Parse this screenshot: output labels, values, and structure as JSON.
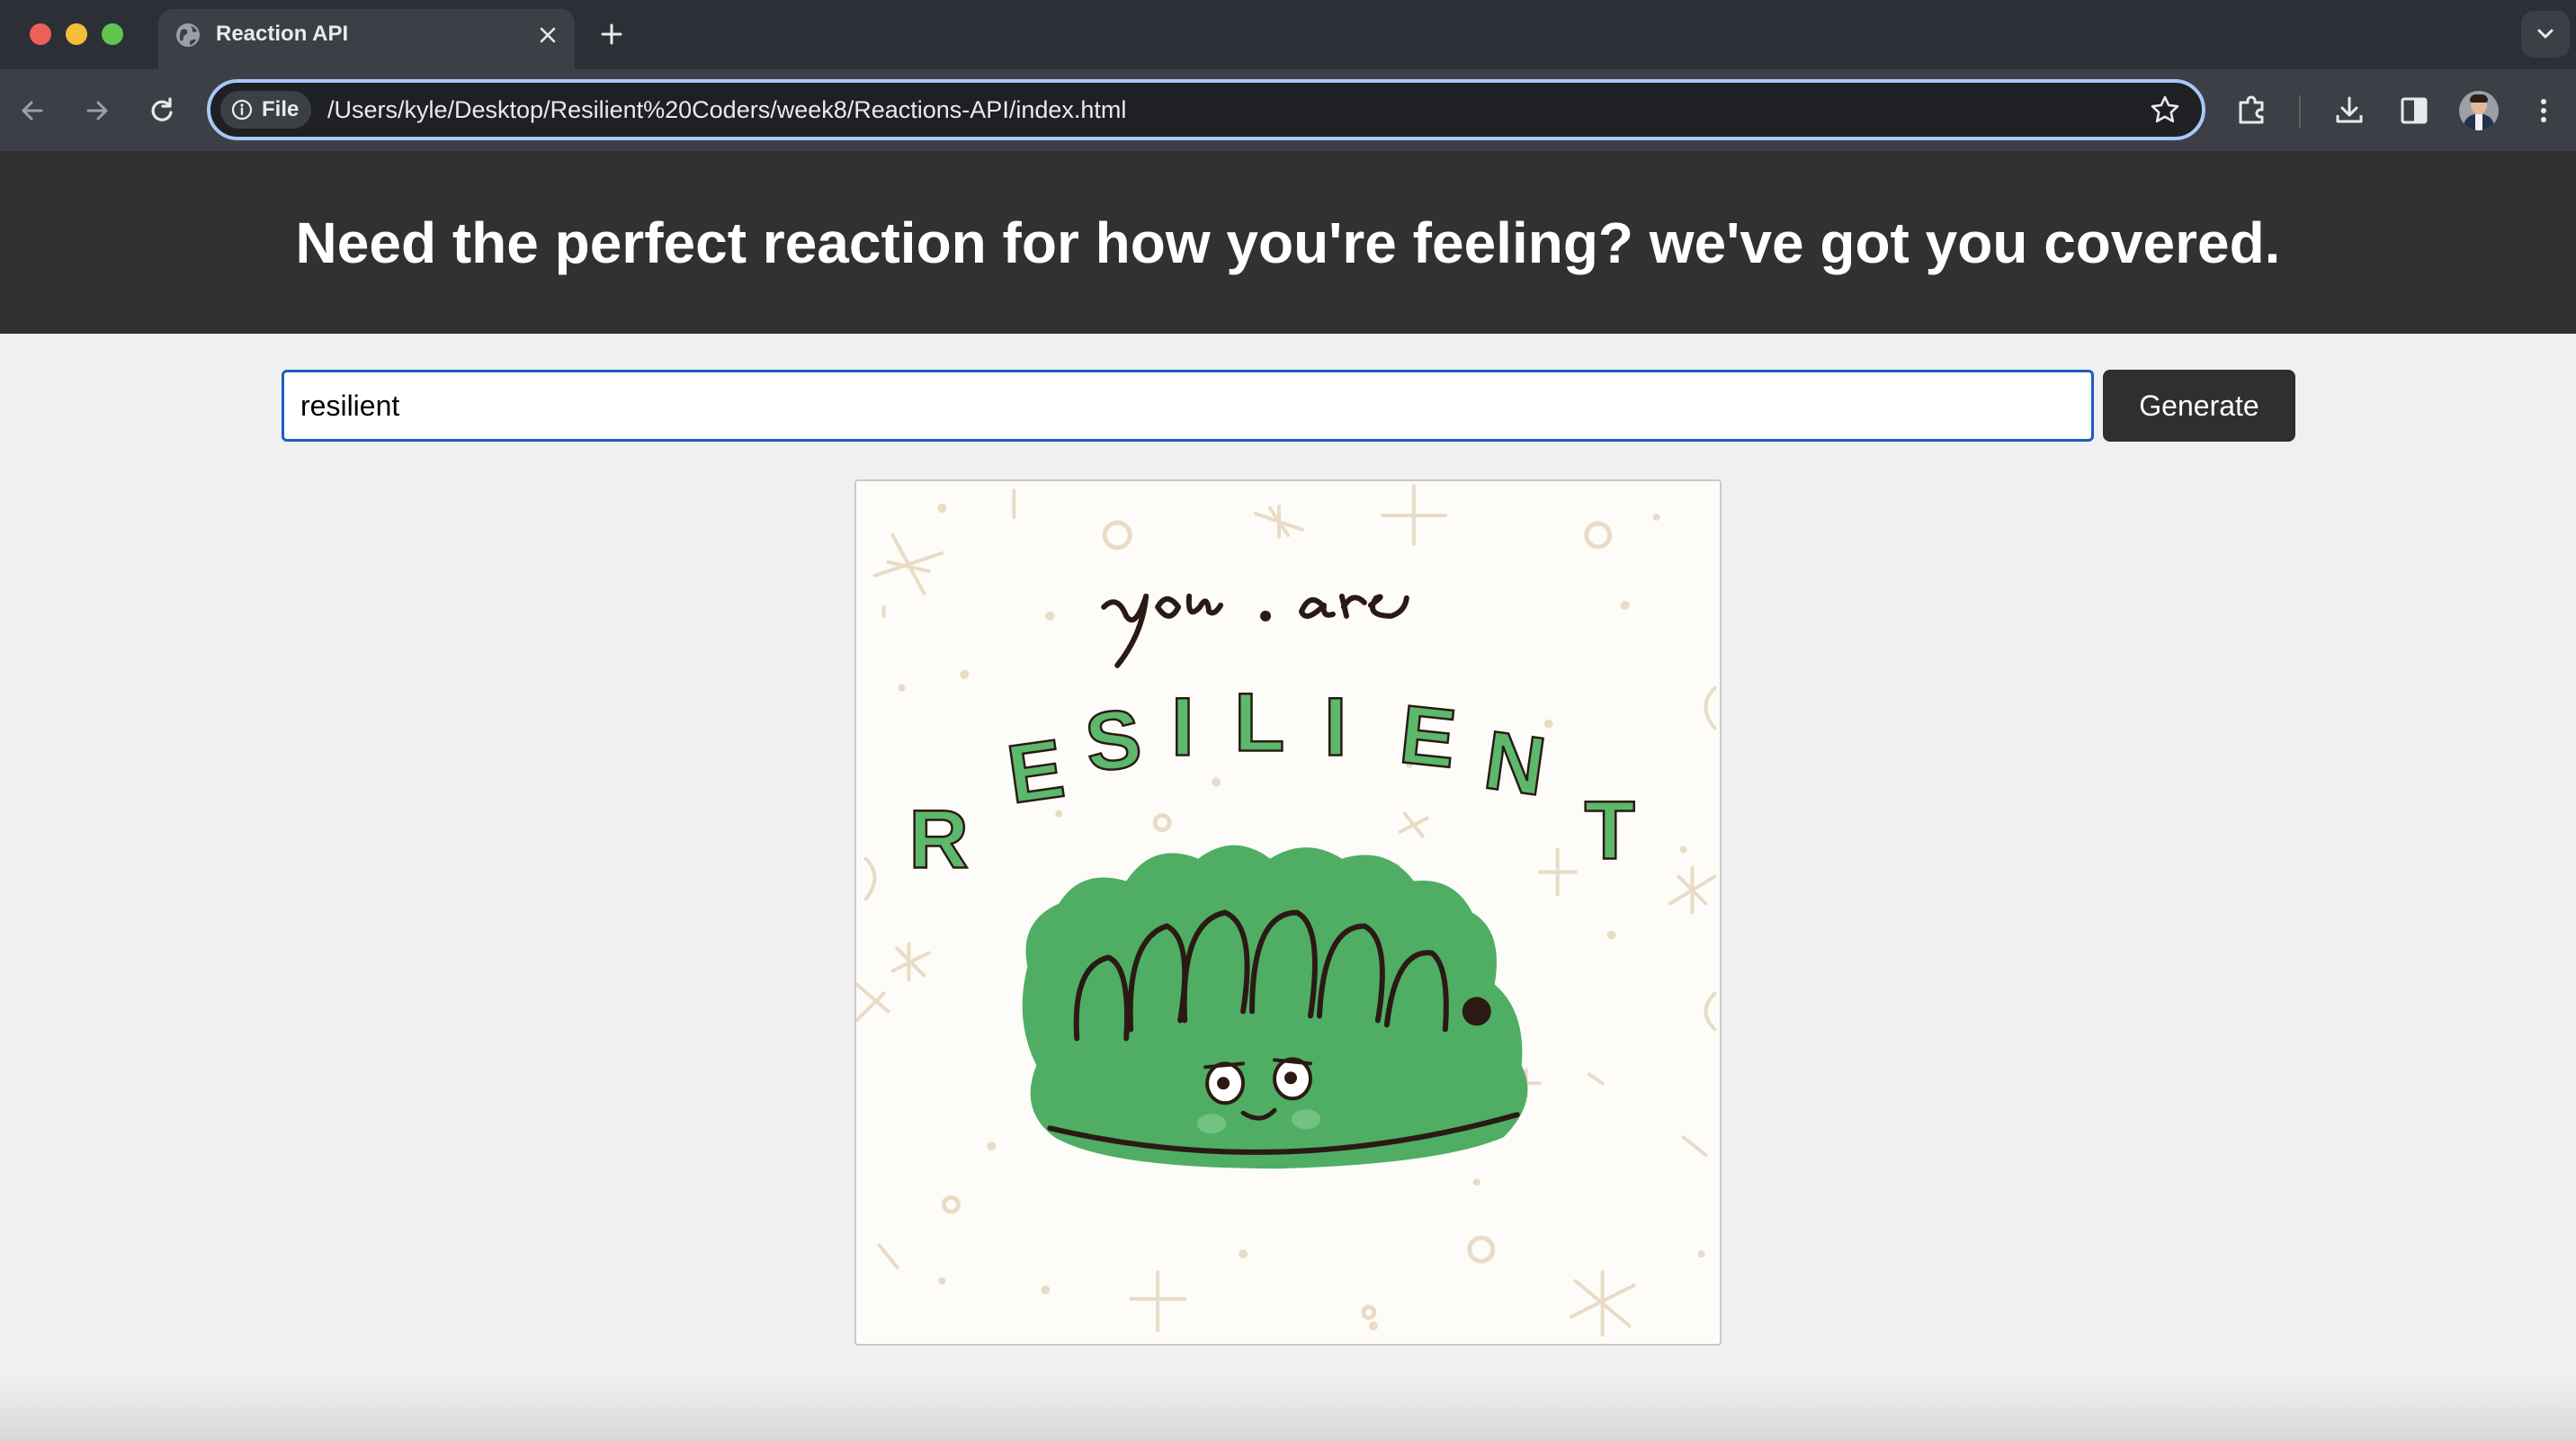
{
  "browser": {
    "tab": {
      "title": "Reaction API",
      "icon": "globe-icon"
    },
    "address_bar": {
      "chip_label": "File",
      "url": "/Users/kyle/Desktop/Resilient%20Coders/week8/Reactions-API/index.html"
    },
    "toolbar_icons": [
      "back-arrow-icon",
      "forward-arrow-icon",
      "reload-icon",
      "bookmark-star-icon",
      "extensions-puzzle-icon",
      "download-icon",
      "side-panel-icon",
      "profile-avatar",
      "more-menu-icon"
    ]
  },
  "page": {
    "header_title": "Need the perfect reaction for how you're feeling? we've got you covered.",
    "search": {
      "value": "resilient"
    },
    "generate_label": "Generate",
    "result_image": {
      "script_text": "you · are",
      "word_letters": [
        "R",
        "E",
        "S",
        "I",
        "L",
        "I",
        "E",
        "N",
        "T"
      ],
      "colors": {
        "letters": "#5cb86b",
        "blob": "#4fae64",
        "ink": "#2b1a14"
      }
    }
  },
  "colors": {
    "chrome_tabbar": "#2c3036",
    "chrome_toolbar": "#3c4046",
    "omnibox_focus": "#a8c7fa",
    "page_header": "#313131",
    "page_background": "#f0f0f0",
    "input_border": "#1f5dbd",
    "button_background": "#2f2f2f"
  }
}
